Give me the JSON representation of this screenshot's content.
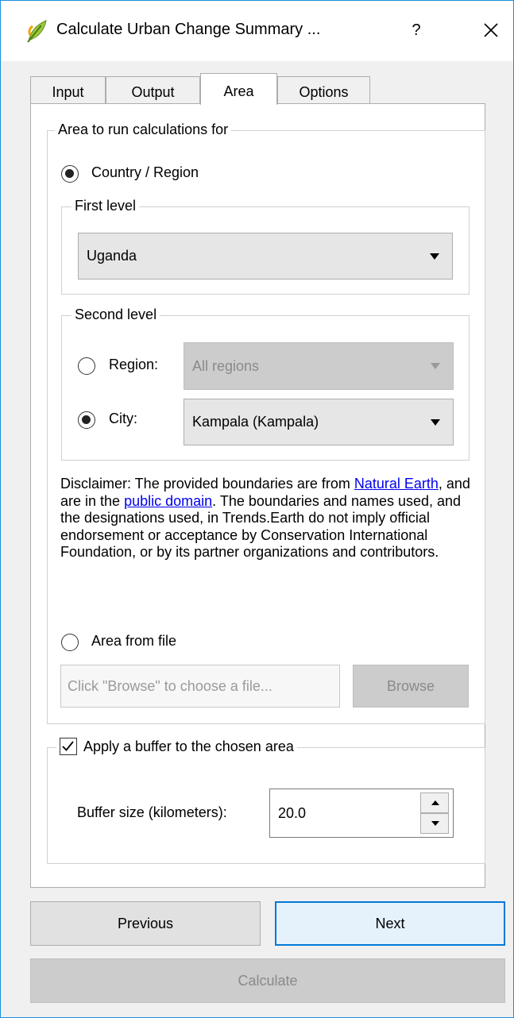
{
  "window": {
    "title": "Calculate Urban Change Summary ...",
    "help": "?",
    "colors": {
      "accent": "#0078d7",
      "link": "#0000ee"
    }
  },
  "tabs": [
    {
      "label": "Input"
    },
    {
      "label": "Output"
    },
    {
      "label": "Area"
    },
    {
      "label": "Options"
    }
  ],
  "area": {
    "group_title": "Area to run calculations for",
    "country_region_label": "Country / Region",
    "country_region_selected": true,
    "first_level": {
      "title": "First level",
      "value": "Uganda"
    },
    "second_level": {
      "title": "Second level",
      "region_label": "Region:",
      "region_value": "All regions",
      "region_selected": false,
      "city_label": "City:",
      "city_value": "Kampala (Kampala)",
      "city_selected": true
    },
    "disclaimer": {
      "part1": "Disclaimer: The provided boundaries are from ",
      "link1": "Natural Earth",
      "part2": ", and are in the ",
      "link2": "public domain",
      "part3": ". The boundaries and names used, and the designations used, in Trends.Earth do not imply official endorsement or acceptance by Conservation International Foundation, or by its partner organizations and contributors."
    },
    "area_from_file_label": "Area from file",
    "area_from_file_selected": false,
    "file_placeholder": "Click \"Browse\" to choose a file...",
    "browse_label": "Browse"
  },
  "buffer": {
    "title": "Apply a buffer to the chosen area",
    "checked": true,
    "size_label": "Buffer size (kilometers):",
    "size_value": "20.0"
  },
  "footer": {
    "previous_label": "Previous",
    "next_label": "Next",
    "calculate_label": "Calculate"
  }
}
